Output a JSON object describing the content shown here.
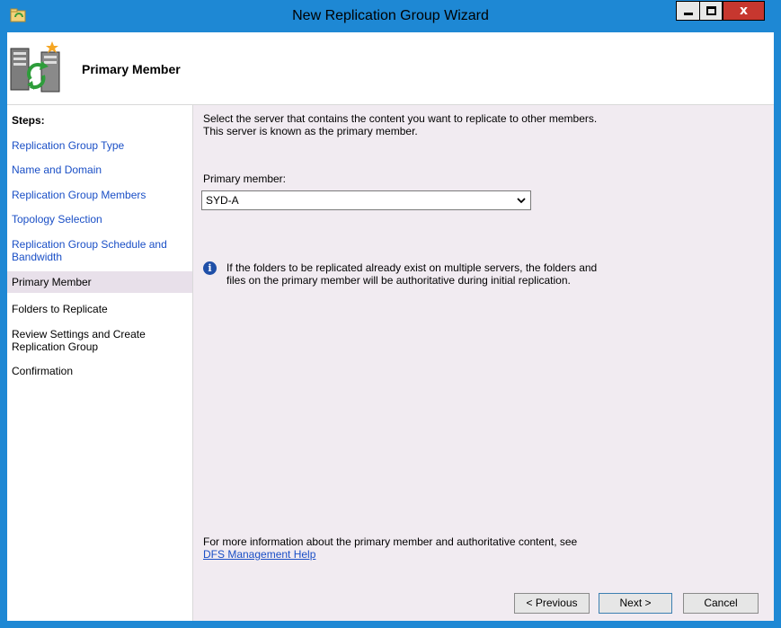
{
  "window": {
    "title": "New Replication Group Wizard",
    "buttons": {
      "minimize": "minimize",
      "maximize": "maximize",
      "close": "x"
    }
  },
  "header": {
    "title": "Primary Member"
  },
  "steps": {
    "heading": "Steps:",
    "items": [
      {
        "label": "Replication Group Type",
        "state": "link"
      },
      {
        "label": "Name and Domain",
        "state": "link"
      },
      {
        "label": "Replication Group Members",
        "state": "link"
      },
      {
        "label": "Topology Selection",
        "state": "link"
      },
      {
        "label": "Replication Group Schedule and Bandwidth",
        "state": "link"
      },
      {
        "label": "Primary Member",
        "state": "current"
      },
      {
        "label": "Folders to Replicate",
        "state": "plain"
      },
      {
        "label": "Review Settings and Create Replication Group",
        "state": "plain"
      },
      {
        "label": "Confirmation",
        "state": "plain"
      }
    ]
  },
  "content": {
    "intro_line1": "Select the server that contains the content you want to replicate to other members.",
    "intro_line2": "This server is known as the primary member.",
    "primary_member_label": "Primary member:",
    "primary_member_value": "SYD-A",
    "info_line1": "If the folders to be replicated already exist on multiple servers, the folders and",
    "info_line2": "files on the primary member will be authoritative during initial replication.",
    "more_info": "For more information about the primary member and authoritative content, see",
    "help_link": "DFS Management Help"
  },
  "buttons": {
    "previous": "< Previous",
    "next": "Next >",
    "cancel": "Cancel"
  },
  "colors": {
    "titlebar": "#1e88d4",
    "link": "#1a4fc6",
    "content_bg": "#f1ebf1",
    "close_button": "#c7372f"
  },
  "icons": {
    "app": "folder-sync-icon",
    "header": "server-replication-icon",
    "info": "info-icon",
    "dropdown": "chevron-down-icon"
  }
}
